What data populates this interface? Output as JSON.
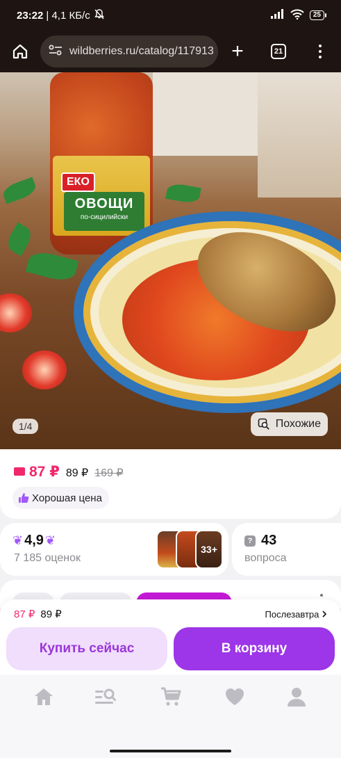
{
  "status_bar": {
    "time": "23:22",
    "network_speed": "| 4,1 КБ/с",
    "battery": "25"
  },
  "browser": {
    "url": "wildberries.ru/catalog/117913",
    "tabs_count": "21"
  },
  "product_image": {
    "brand_on_jar": "ЕКО",
    "jar_title": "ОВОЩИ",
    "jar_subtitle": "по-сицилийски",
    "pager": "1/4",
    "similar_label": "Похожие"
  },
  "price": {
    "wallet_price": "87 ₽",
    "price": "89 ₽",
    "old_price": "169 ₽",
    "badge": "Хорошая цена"
  },
  "rating": {
    "value": "4,9",
    "count": "7 185 оценок",
    "photos_more": "33+"
  },
  "questions": {
    "count": "43",
    "label": "вопроса"
  },
  "buy_bar": {
    "wallet_price": "87 ₽",
    "price": "89 ₽",
    "delivery": "Послезавтра",
    "buy_now": "Купить сейчас",
    "add_to_cart": "В корзину"
  },
  "bottom_nav": {
    "items": [
      "home-icon",
      "catalog-search-icon",
      "cart-icon",
      "favorites-icon",
      "profile-icon"
    ],
    "icon_color": "#bdbcc2"
  },
  "colors": {
    "accent_pink": "#f0286a",
    "accent_purple": "#9d35e8",
    "status_bar_bg": "#1e1411"
  }
}
